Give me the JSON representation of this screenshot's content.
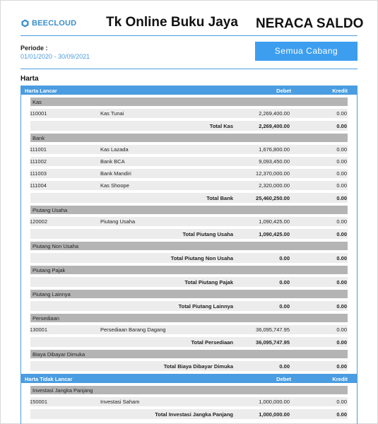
{
  "header": {
    "logo_text": "BEECLOUD",
    "company": "Tk Online Buku Jaya",
    "report_title": "NERACA SALDO",
    "periode_label": "Periode :",
    "periode_value": "01/01/2020 -  30/09/2021",
    "branch_button": "Semua  Cabang",
    "accent_color": "#3d9ef0"
  },
  "section": "Harta",
  "columns": {
    "debet": "Debet",
    "kredit": "Kredit"
  },
  "rows": [
    {
      "type": "head",
      "label": "Harta Lancar"
    },
    {
      "type": "group",
      "label": "Kas"
    },
    {
      "type": "item",
      "code": "110001",
      "name": "Kas Tunai",
      "debet": "2,269,400.00",
      "kredit": "0.00"
    },
    {
      "type": "total",
      "name": "Total Kas",
      "debet": "2,269,400.00",
      "kredit": "0.00"
    },
    {
      "type": "group",
      "label": "Bank"
    },
    {
      "type": "item",
      "code": "111001",
      "name": "Kas Lazada",
      "debet": "1,676,800.00",
      "kredit": "0.00"
    },
    {
      "type": "item",
      "code": "111002",
      "name": "Bank BCA",
      "debet": "9,093,450.00",
      "kredit": "0.00"
    },
    {
      "type": "item",
      "code": "111003",
      "name": "Bank Mandiri",
      "debet": "12,370,000.00",
      "kredit": "0.00"
    },
    {
      "type": "item",
      "code": "111004",
      "name": "Kas Shoope",
      "debet": "2,320,000.00",
      "kredit": "0.00"
    },
    {
      "type": "total",
      "name": "Total Bank",
      "debet": "25,460,250.00",
      "kredit": "0.00"
    },
    {
      "type": "group",
      "label": "Piutang Usaha"
    },
    {
      "type": "item",
      "code": "120002",
      "name": "Piutang Usaha",
      "debet": "1,090,425.00",
      "kredit": "0.00"
    },
    {
      "type": "total",
      "name": "Total Piutang Usaha",
      "debet": "1,090,425.00",
      "kredit": "0.00"
    },
    {
      "type": "group",
      "label": "Piutang Non Usaha"
    },
    {
      "type": "total",
      "name": "Total Piutang Non Usaha",
      "debet": "0.00",
      "kredit": "0.00"
    },
    {
      "type": "group",
      "label": "Piutang Pajak"
    },
    {
      "type": "total",
      "name": "Total Piutang Pajak",
      "debet": "0.00",
      "kredit": "0.00"
    },
    {
      "type": "group",
      "label": "Piutang Lainnya"
    },
    {
      "type": "total",
      "name": "Total Piutang Lainnya",
      "debet": "0.00",
      "kredit": "0.00"
    },
    {
      "type": "group",
      "label": "Persediaan"
    },
    {
      "type": "item",
      "code": "130001",
      "name": "Persediaan Barang Dagang",
      "debet": "36,095,747.95",
      "kredit": "0.00"
    },
    {
      "type": "total",
      "name": "Total Persediaan",
      "debet": "36,095,747.95",
      "kredit": "0.00"
    },
    {
      "type": "group",
      "label": "Biaya Dibayar Dimuka"
    },
    {
      "type": "total",
      "name": "Total Biaya Dibayar Dimuka",
      "debet": "0.00",
      "kredit": "0.00"
    },
    {
      "type": "head",
      "label": "Harta Tidak Lancar"
    },
    {
      "type": "group",
      "label": "Investasi Jangka Panjang"
    },
    {
      "type": "item",
      "code": "150001",
      "name": "Investasi Saham",
      "debet": "1,000,000.00",
      "kredit": "0.00"
    },
    {
      "type": "total",
      "name": "Total Investasi Jangka Panjang",
      "debet": "1,000,000.00",
      "kredit": "0.00"
    }
  ]
}
